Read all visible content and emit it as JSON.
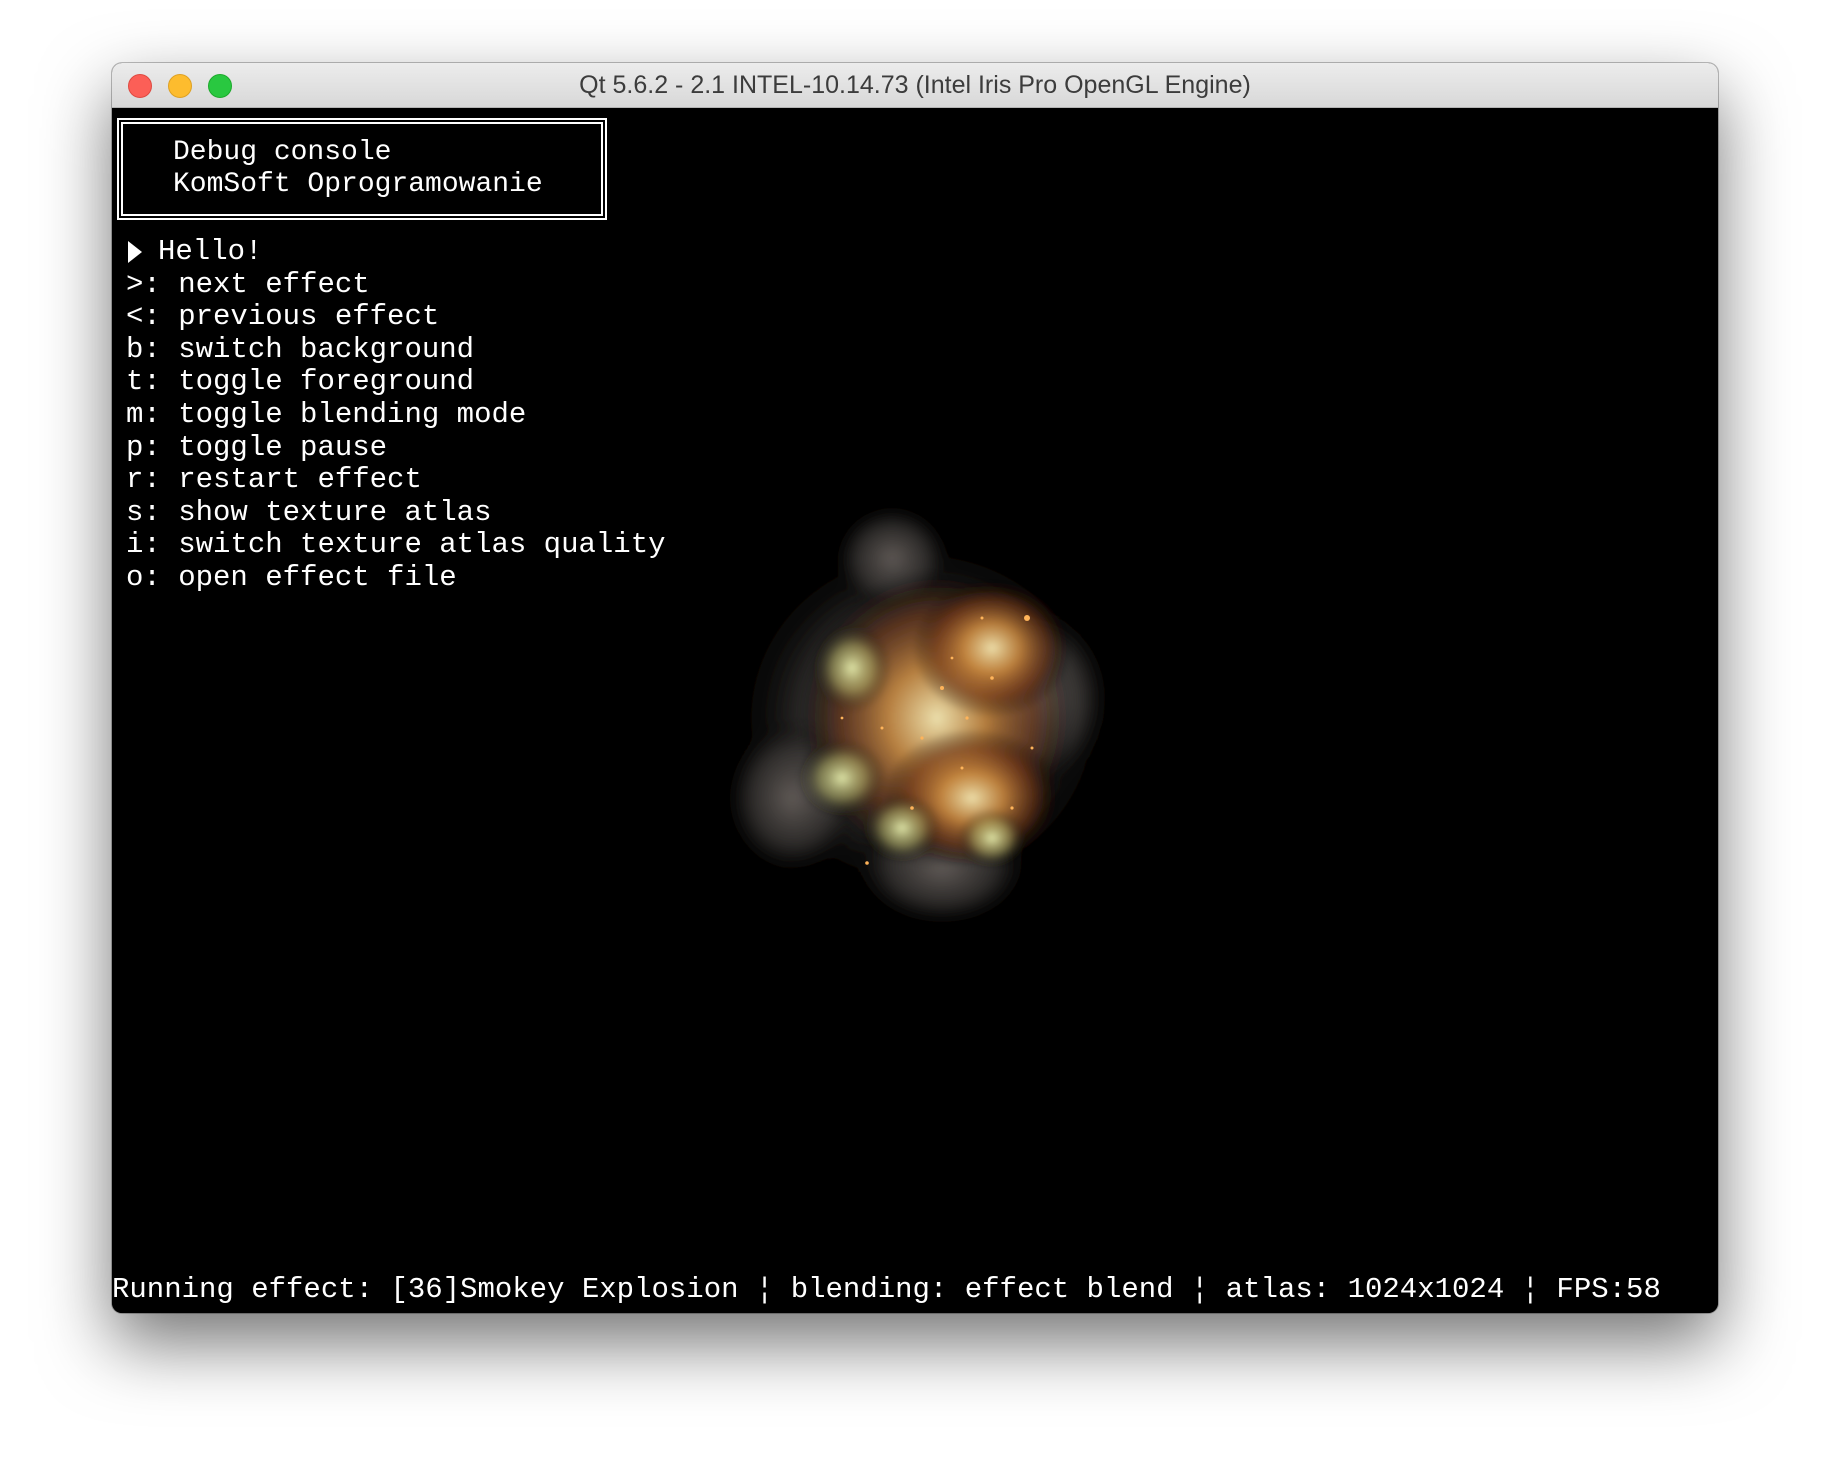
{
  "window": {
    "title": "Qt 5.6.2 - 2.1 INTEL-10.14.73 (Intel Iris Pro OpenGL Engine)"
  },
  "header": {
    "line1": "Debug console",
    "line2": "KomSoft Oprogramowanie"
  },
  "menu": {
    "greeting": "Hello!",
    "items": [
      {
        "key": ">:",
        "label": "next effect"
      },
      {
        "key": "<:",
        "label": "previous effect"
      },
      {
        "key": "b:",
        "label": "switch background"
      },
      {
        "key": "t:",
        "label": "toggle foreground"
      },
      {
        "key": "m:",
        "label": "toggle blending mode"
      },
      {
        "key": "p:",
        "label": "toggle pause"
      },
      {
        "key": "r:",
        "label": "restart effect"
      },
      {
        "key": "s:",
        "label": "show texture atlas"
      },
      {
        "key": "i:",
        "label": "switch texture atlas quality"
      },
      {
        "key": "o:",
        "label": "open effect file"
      }
    ]
  },
  "status": {
    "text": "Running effect: [36]Smokey Explosion ¦ blending: effect blend ¦ atlas: 1024x1024 ¦ FPS:58"
  },
  "colors": {
    "background": "#000000",
    "text": "#ffffff",
    "close": "#fc5f57",
    "minimize": "#fdbc2e",
    "maximize": "#29c840"
  }
}
